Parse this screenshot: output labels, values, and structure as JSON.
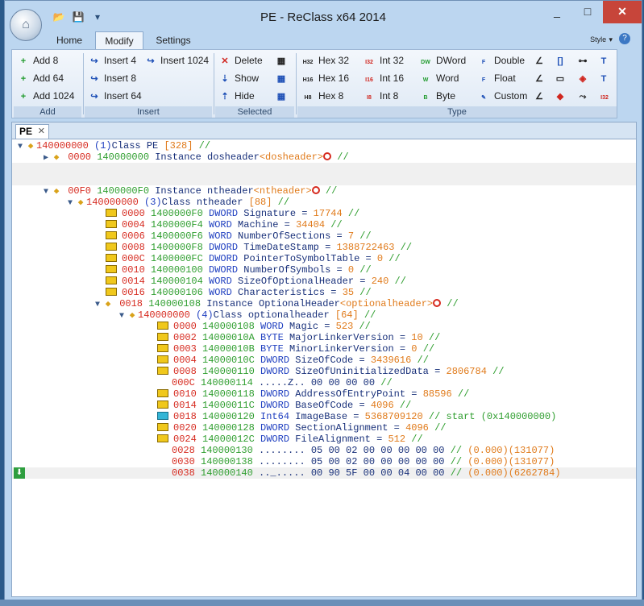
{
  "window": {
    "title": "PE - ReClass x64 2014",
    "controls": [
      "_",
      "□",
      "✕"
    ]
  },
  "quick_access": [
    "open-icon",
    "save-icon",
    "dropdown-icon"
  ],
  "ribbon_tabs": [
    "Home",
    "Modify",
    "Settings"
  ],
  "active_tab": "Modify",
  "style_label": "Style",
  "help_label": "?",
  "ribbon": {
    "add": {
      "label": "Add",
      "buttons": [
        "Add 8",
        "Add 64",
        "Add 1024"
      ]
    },
    "insert": {
      "label": "Insert",
      "buttons": [
        "Insert 4",
        "Insert 8",
        "Insert 64",
        "Insert 1024"
      ]
    },
    "selected": {
      "label": "Selected",
      "buttons": [
        "Delete",
        "Show",
        "Hide"
      ]
    },
    "type": {
      "label": "Type",
      "buttons": [
        "Hex 32",
        "Hex 16",
        "Hex 8",
        "Int 32",
        "Int 16",
        "Int 8",
        "DWord",
        "Word",
        "Byte",
        "Double",
        "Float",
        "Custom"
      ],
      "icon_tags": [
        "H32",
        "H16",
        "H8",
        "I32",
        "I16",
        "I8",
        "DW",
        "W",
        "B",
        "F",
        "F",
        "✎"
      ]
    },
    "extra_icons": [
      "T",
      "T",
      "I32"
    ]
  },
  "document_tab": {
    "label": "PE",
    "close": "✕"
  },
  "tree": {
    "root": {
      "addr": "140000000",
      "idx": "(1)",
      "kw": "Class",
      "name": "PE",
      "size": "[328]",
      "cmt": "//"
    },
    "dosheader": {
      "off": "0000",
      "addr": "140000000",
      "kw": "Instance",
      "name": "dosheader",
      "type": "<dosheader>",
      "cmt": "//"
    },
    "ntheader": {
      "off": "00F0",
      "addr": "1400000F0",
      "kw": "Instance",
      "name": "ntheader",
      "type": "<ntheader>",
      "cmt": "//"
    },
    "ntclass": {
      "addr": "140000000",
      "idx": "(3)",
      "kw": "Class",
      "name": "ntheader",
      "size": "[88]",
      "cmt": "//"
    },
    "nt_fields": [
      {
        "off": "0000",
        "addr": "1400000F0",
        "type": "DWORD",
        "name": "Signature",
        "eq": "=",
        "val": "17744",
        "cmt": "//"
      },
      {
        "off": "0004",
        "addr": "1400000F4",
        "type": "WORD",
        "name": "Machine",
        "eq": "=",
        "val": "34404",
        "cmt": "//"
      },
      {
        "off": "0006",
        "addr": "1400000F6",
        "type": "WORD",
        "name": "NumberOfSections",
        "eq": "=",
        "val": "7",
        "cmt": "//"
      },
      {
        "off": "0008",
        "addr": "1400000F8",
        "type": "DWORD",
        "name": "TimeDateStamp",
        "eq": "=",
        "val": "1388722463",
        "cmt": "//"
      },
      {
        "off": "000C",
        "addr": "1400000FC",
        "type": "DWORD",
        "name": "PointerToSymbolTable",
        "eq": "=",
        "val": "0",
        "cmt": "//"
      },
      {
        "off": "0010",
        "addr": "140000100",
        "type": "DWORD",
        "name": "NumberOfSymbols",
        "eq": "=",
        "val": "0",
        "cmt": "//"
      },
      {
        "off": "0014",
        "addr": "140000104",
        "type": "WORD",
        "name": "SizeOfOptionalHeader",
        "eq": "=",
        "val": "240",
        "cmt": "//"
      },
      {
        "off": "0016",
        "addr": "140000106",
        "type": "WORD",
        "name": "Characteristics",
        "eq": "=",
        "val": "35",
        "cmt": "//"
      }
    ],
    "optheader": {
      "off": "0018",
      "addr": "140000108",
      "kw": "Instance",
      "name": "OptionalHeader",
      "type": "<optionalheader>",
      "cmt": "//"
    },
    "optclass": {
      "addr": "140000000",
      "idx": "(4)",
      "kw": "Class",
      "name": "optionalheader",
      "size": "[64]",
      "cmt": "//"
    },
    "opt_fields": [
      {
        "off": "0000",
        "addr": "140000108",
        "type": "WORD",
        "name": "Magic",
        "eq": "=",
        "val": "523",
        "cmt": "//"
      },
      {
        "off": "0002",
        "addr": "14000010A",
        "type": "BYTE",
        "name": "MajorLinkerVersion",
        "eq": "=",
        "val": "10",
        "cmt": "//"
      },
      {
        "off": "0003",
        "addr": "14000010B",
        "type": "BYTE",
        "name": "MinorLinkerVersion",
        "eq": "=",
        "val": "0",
        "cmt": "//"
      },
      {
        "off": "0004",
        "addr": "14000010C",
        "type": "DWORD",
        "name": "SizeOfCode",
        "eq": "=",
        "val": "3439616",
        "cmt": "//"
      },
      {
        "off": "0008",
        "addr": "140000110",
        "type": "DWORD",
        "name": "SizeOfUninitializedData",
        "eq": "=",
        "val": "2806784",
        "cmt": "//"
      }
    ],
    "opt_pad": {
      "off": "000C",
      "addr": "140000114",
      "ascii": ".....Z..",
      "hex": "00 00 00 00",
      "cmt": "//"
    },
    "opt_fields2": [
      {
        "off": "0010",
        "addr": "140000118",
        "type": "DWORD",
        "name": "AddressOfEntryPoint",
        "eq": "=",
        "val": "88596",
        "cmt": "//"
      },
      {
        "off": "0014",
        "addr": "14000011C",
        "type": "DWORD",
        "name": "BaseOfCode",
        "eq": "=",
        "val": "4096",
        "cmt": "//"
      },
      {
        "off": "0018",
        "addr": "140000120",
        "type": "Int64",
        "name": "ImageBase",
        "eq": "=",
        "val": "5368709120",
        "cmt": "// start (0x140000000)"
      },
      {
        "off": "0020",
        "addr": "140000128",
        "type": "DWORD",
        "name": "SectionAlignment",
        "eq": "=",
        "val": "4096",
        "cmt": "//"
      },
      {
        "off": "0024",
        "addr": "14000012C",
        "type": "DWORD",
        "name": "FileAlignment",
        "eq": "=",
        "val": "512",
        "cmt": "//"
      }
    ],
    "hex_rows": [
      {
        "off": "0028",
        "addr": "140000130",
        "ascii": "........",
        "hex": "05 00 02 00 00 00 00 00",
        "cmt": "//",
        "extra": "(0.000)(131077)"
      },
      {
        "off": "0030",
        "addr": "140000138",
        "ascii": "........",
        "hex": "05 00 02 00 00 00 00 00",
        "cmt": "//",
        "extra": "(0.000)(131077)"
      },
      {
        "off": "0038",
        "addr": "140000140",
        "ascii": ".._.....",
        "hex": "00 90 5F 00 00 04 00 00",
        "cmt": "//",
        "extra": "(0.000)(6262784)"
      }
    ]
  }
}
